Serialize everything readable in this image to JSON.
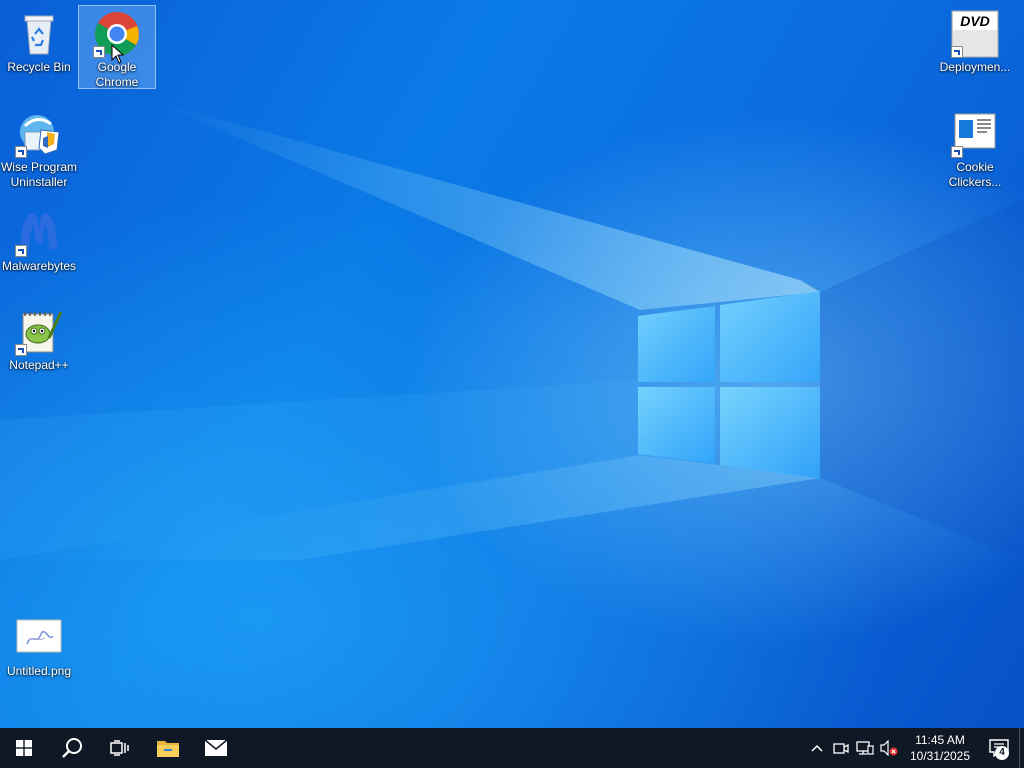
{
  "desktop": {
    "wallpaper": "windows-10-hero",
    "accent_color": "#0a6fe0",
    "icons": {
      "recycle_bin": {
        "label": "Recycle Bin",
        "icon": "recycle-bin-icon"
      },
      "google_chrome": {
        "label": "Google\nChrome",
        "icon": "chrome-icon",
        "selected": true
      },
      "wise_program_uninstaller": {
        "label": "Wise Program\nUninstaller",
        "icon": "wise-uninstaller-icon"
      },
      "malwarebytes": {
        "label": "Malwarebytes",
        "icon": "malwarebytes-icon"
      },
      "notepadpp": {
        "label": "Notepad++",
        "icon": "notepadpp-icon"
      },
      "untitled_png": {
        "label": "Untitled.png",
        "icon": "image-file-icon"
      },
      "deployment": {
        "label": "Deploymen...",
        "icon": "dvd-icon"
      },
      "cookie_clickers": {
        "label": "Cookie\nClickers...",
        "icon": "cookie-clickers-icon"
      }
    }
  },
  "taskbar": {
    "background": "#101826",
    "buttons": [
      {
        "name": "start",
        "icon": "windows-start-icon"
      },
      {
        "name": "search",
        "icon": "search-icon"
      },
      {
        "name": "task-view",
        "icon": "task-view-icon"
      },
      {
        "name": "file-explorer",
        "icon": "folder-icon"
      },
      {
        "name": "mail",
        "icon": "mail-icon"
      }
    ],
    "tray": {
      "icons": [
        "chevron-up-icon",
        "meet-now-icon",
        "network-icon",
        "volume-muted-icon"
      ],
      "time": "11:45 AM",
      "date": "10/31/2025",
      "notification_count": "4"
    }
  }
}
